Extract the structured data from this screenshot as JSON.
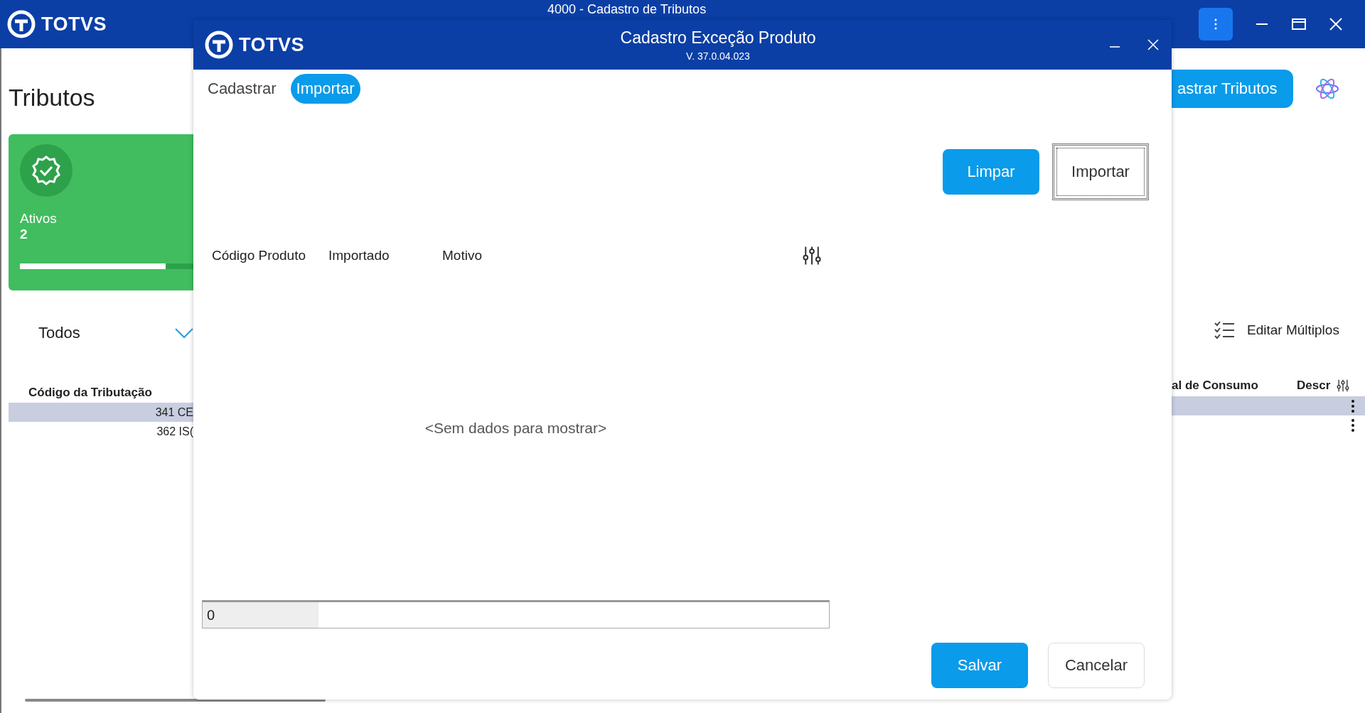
{
  "app_window": {
    "logo": "TOTVS",
    "title": "4000 - Cadastro de Tributos"
  },
  "page": {
    "heading": "Tributos",
    "status_card": {
      "label": "Ativos",
      "count": "2",
      "level": 0.84
    },
    "filter": {
      "value": "Todos"
    },
    "primary_button": "astrar Tributos",
    "multi_edit": "Editar Múltiplos",
    "table": {
      "columns_left": [
        "Código da Tributação"
      ],
      "columns_right": [
        "al de Consumo",
        "Descr"
      ],
      "rows": [
        {
          "cell": "341 CE",
          "selected": true
        },
        {
          "cell": "362 IS(",
          "selected": false
        }
      ]
    }
  },
  "dialog": {
    "logo": "TOTVS",
    "title": "Cadastro Exceção Produto",
    "version": "V. 37.0.04.023",
    "tabs": [
      {
        "label": "Cadastrar",
        "selected": false
      },
      {
        "label": "Importar",
        "selected": true
      }
    ],
    "actions": [
      {
        "label": "Limpar",
        "kind": "primary",
        "focused": false
      },
      {
        "label": "Importar",
        "kind": "secondary",
        "focused": true
      }
    ],
    "table": {
      "columns": [
        "Código Produto",
        "Importado",
        "Motivo"
      ],
      "empty_message": "<Sem dados para mostrar>"
    },
    "progress": {
      "label": "0",
      "level": 0.185
    },
    "footer": [
      {
        "label": "Salvar",
        "kind": "primary"
      },
      {
        "label": "Cancelar",
        "kind": "secondary"
      }
    ]
  }
}
